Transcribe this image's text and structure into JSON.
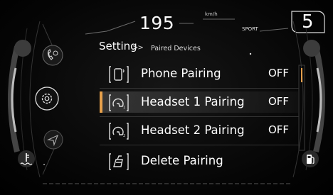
{
  "header": {
    "speed": "195",
    "speed_unit": "km/h",
    "drive_mode": "SPORT",
    "gear": "5"
  },
  "breadcrumb": {
    "title": "Setting",
    "separator": ">>",
    "current": "Paired Devices"
  },
  "menu": {
    "items": [
      {
        "icon": "phone-pairing-icon",
        "label": "Phone Pairing",
        "value": "OFF",
        "selected": false
      },
      {
        "icon": "headset-1-icon",
        "label": "Headset 1 Pairing",
        "value": "OFF",
        "selected": true
      },
      {
        "icon": "headset-2-icon",
        "label": "Headset 2 Pairing",
        "value": "OFF",
        "selected": false
      },
      {
        "icon": "delete-pairing-icon",
        "label": "Delete Pairing",
        "value": "",
        "selected": false
      }
    ]
  },
  "side_nav": {
    "icons": [
      "phone-call-icon",
      "settings-gear-icon",
      "navigation-arrow-icon"
    ]
  },
  "gauges": {
    "left_icon": "coolant-temperature-icon",
    "right_icon": "fuel-pump-icon"
  },
  "colors": {
    "accent": "#e6a04b",
    "text": "#ffffff",
    "background": "#000000"
  }
}
